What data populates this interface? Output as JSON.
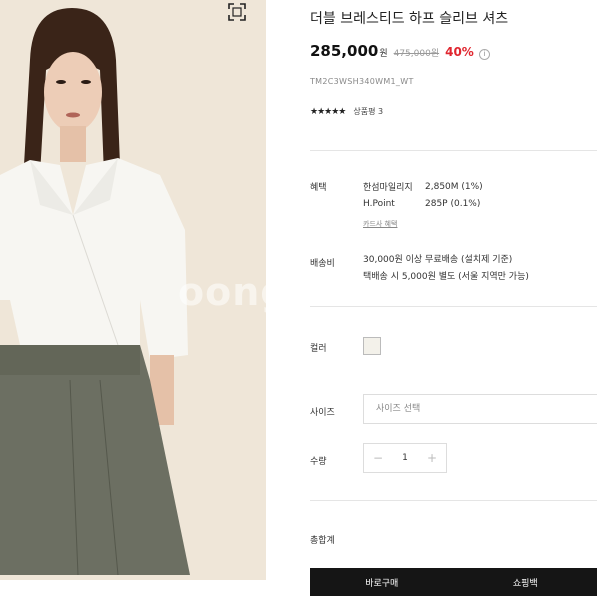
{
  "product": {
    "title": "더블 브레스티드 하프 슬리브 셔츠",
    "price": "285,000",
    "currency": "원",
    "original_price": "475,000원",
    "discount": "40%",
    "code": "TM2C3WSH340WM1_WT",
    "rating": "★★★★★",
    "review_link": "상품평 3"
  },
  "benefit": {
    "label": "혜택",
    "rows": [
      {
        "key": "한섬마일리지",
        "value": "2,850M (1%)"
      },
      {
        "key": "H.Point",
        "value": "285P (0.1%)"
      }
    ],
    "more_link": "카드사 혜택"
  },
  "delivery": {
    "label": "배송비",
    "lines": [
      "30,000원 이상 무료배송 (설치제 기준)",
      "택배송 시 5,000원 별도 (서울 지역만 가능)"
    ]
  },
  "color": {
    "label": "컬러",
    "swatch": "#f3f1ea"
  },
  "size": {
    "label": "사이즈",
    "placeholder": "사이즈 선택"
  },
  "quantity": {
    "label": "수량",
    "minus": "−",
    "value": "1",
    "plus": "+"
  },
  "total": {
    "label": "총합계"
  },
  "actions": {
    "left": "바로구매",
    "right": "쇼핑백"
  },
  "watermark": "oong"
}
